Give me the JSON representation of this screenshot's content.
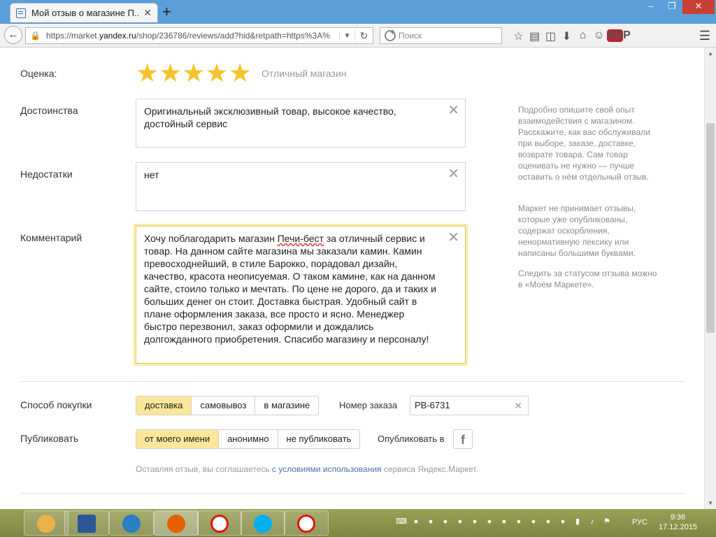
{
  "browser": {
    "tab_title": "Мой отзыв о магазине П...",
    "url_prefix": "https://market.",
    "url_domain": "yandex.ru",
    "url_suffix": "/shop/236786/reviews/add?hid&retpath=https%3A%",
    "search_placeholder": "Поиск",
    "adblock_label": "ABP"
  },
  "form": {
    "rating_label": "Оценка:",
    "rating_value": 5,
    "rating_max": 5,
    "rating_text": "Отличный магазин",
    "pros_label": "Достоинства",
    "pros_value": "Оригинальный эксклюзивный товар, высокое качество, достойный сервис",
    "cons_label": "Недостатки",
    "cons_value": "нет",
    "comment_label": "Комментарий",
    "comment_part1": "Хочу поблагодарить магазин ",
    "comment_misspelled": "Печи-бест",
    "comment_part2": " за отличный сервис и товар. На данном сайте магазина мы заказали камин. Камин превосходнейший, в стиле Барокко, порадовал дизайн, качество, красота неописуемая. О таком камине, как на данном сайте, стоило только и мечтать. По цене не дорого, да и таких и больших денег он стоит. Доставка быстрая. Удобный сайт в плане оформления заказа, все просто и ясно. Менеджер быстро перезвонил, заказ оформили и дождались долгожданного приобретения. Спасибо магазину и персоналу!",
    "purchase_label": "Способ покупки",
    "purchase_options": [
      "доставка",
      "самовывоз",
      "в магазине"
    ],
    "purchase_selected": 0,
    "order_label": "Номер заказа",
    "order_value": "PB-6731",
    "publish_label": "Публиковать",
    "publish_options": [
      "от моего имени",
      "анонимно",
      "не публиковать"
    ],
    "publish_selected": 0,
    "publish_in_label": "Опубликовать в",
    "terms_before": "Оставляя отзыв, вы соглашаетесь ",
    "terms_link": "с условиями использования",
    "terms_after": " сервиса Яндекс.Маркет."
  },
  "help": {
    "p1": "Подробно опишите свой опыт взаимодействия с магазином. Расскажите, как вас обслуживали при выборе, заказе, доставке, возврате товара. Сам товар оценивать не нужно — лучше оставить о нём отдельный отзыв.",
    "p2": "Маркет не принимает отзывы, которые уже опубликованы, содержат оскорбления, ненормативную лексику или написаны большими буквами.",
    "p3": "Следить за статусом отзыва можно в «Моём Маркете»."
  },
  "taskbar": {
    "lang": "РУС",
    "time": "9:36",
    "date": "17.12.2015"
  },
  "colors": {
    "star": "#f7c32b",
    "selected_segment": "#fbe79a",
    "link": "#4d6fa1"
  }
}
